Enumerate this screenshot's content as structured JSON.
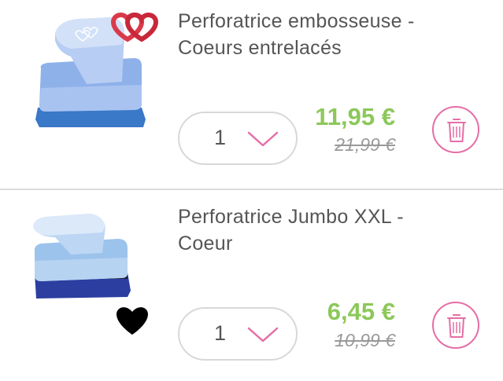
{
  "colors": {
    "price_green": "#8cc85a",
    "delete_pink": "#e56ea6",
    "chevron_pink": "#e56ea6",
    "text_gray": "#555555",
    "old_price_gray": "#999999",
    "border_gray": "#d8d8d8"
  },
  "cart": {
    "items": [
      {
        "title_line1": "Perforatrice embosseuse -",
        "title_line2": "Coeurs entrelacés",
        "quantity": "1",
        "price": "11,95 €",
        "old_price": "21,99 €",
        "quantity_icon": "chevron-down-icon",
        "delete_icon": "trash-icon"
      },
      {
        "title_line1": "Perforatrice Jumbo XXL -",
        "title_line2": "Coeur",
        "quantity": "1",
        "price": "6,45 €",
        "old_price": "10,99 €",
        "quantity_icon": "chevron-down-icon",
        "delete_icon": "trash-icon"
      }
    ]
  }
}
